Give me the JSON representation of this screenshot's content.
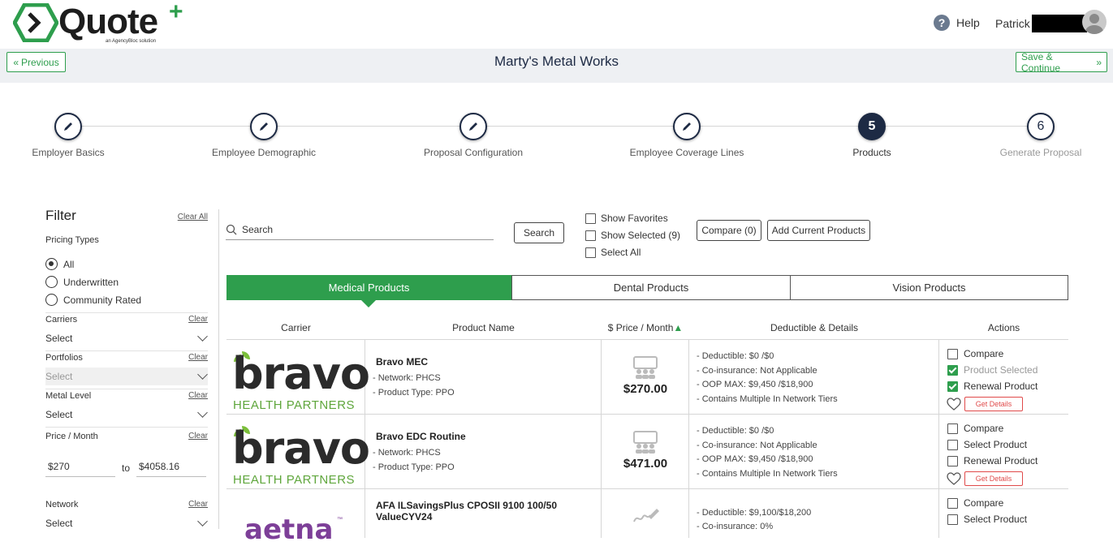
{
  "header": {
    "logo_text": "Quote",
    "logo_plus": "+",
    "logo_sub": "an AgencyBloc solution",
    "help_label": "Help",
    "user_name": "Patrick"
  },
  "nav": {
    "previous_label": "Previous",
    "company_name": "Marty's Metal Works",
    "save_label": "Save & Continue"
  },
  "steps": [
    {
      "label": "Employer Basics",
      "state": "done"
    },
    {
      "label": "Employee Demographic",
      "state": "done"
    },
    {
      "label": "Proposal Configuration",
      "state": "done"
    },
    {
      "label": "Employee Coverage Lines",
      "state": "done"
    },
    {
      "label": "Products",
      "number": "5",
      "state": "current"
    },
    {
      "label": "Generate Proposal",
      "number": "6",
      "state": "future"
    }
  ],
  "filter": {
    "title": "Filter",
    "clear_all": "Clear All",
    "pricing_types_label": "Pricing Types",
    "pricing_types": [
      "All",
      "Underwritten",
      "Community Rated"
    ],
    "pricing_selected": "All",
    "carriers": {
      "label": "Carriers",
      "clear": "Clear",
      "value": "Select"
    },
    "portfolios": {
      "label": "Portfolios",
      "clear": "Clear",
      "value": "Select"
    },
    "metal_level": {
      "label": "Metal Level",
      "clear": "Clear",
      "value": "Select"
    },
    "price_month": {
      "label": "Price / Month",
      "clear": "Clear",
      "min": "$270",
      "to": "to",
      "max": "$4058.16"
    },
    "network": {
      "label": "Network",
      "clear": "Clear",
      "value": "Select"
    }
  },
  "toolbar": {
    "search_placeholder": "Search",
    "search_button": "Search",
    "show_favorites": "Show Favorites",
    "show_selected": "Show Selected (9)",
    "select_all": "Select All",
    "compare_button": "Compare (0)",
    "add_current_button": "Add Current Products"
  },
  "tabs": [
    "Medical Products",
    "Dental Products",
    "Vision Products"
  ],
  "active_tab": "Medical Products",
  "table": {
    "headers": [
      "Carrier",
      "Product Name",
      "$ Price / Month",
      "Deductible & Details",
      "Actions"
    ],
    "sort_indicator": "▲",
    "rows": [
      {
        "carrier": "bravo",
        "carrier_sub": "HEALTH PARTNERS",
        "product_name": "Bravo MEC",
        "network": "- Network: PHCS",
        "product_type": "- Product Type: PPO",
        "price": "$270.00",
        "details": [
          "- Deductible: $0 /$0",
          "- Co-insurance: Not Applicable",
          "- OOP MAX: $9,450 /$18,900",
          "- Contains Multiple In Network Tiers"
        ],
        "actions": [
          {
            "label": "Compare",
            "checked": false,
            "dim": false
          },
          {
            "label": "Product Selected",
            "checked": true,
            "dim": true
          },
          {
            "label": "Renewal Product",
            "checked": true,
            "dim": false
          }
        ],
        "get_details": "Get Details"
      },
      {
        "carrier": "bravo",
        "carrier_sub": "HEALTH PARTNERS",
        "product_name": "Bravo EDC Routine",
        "network": "- Network: PHCS",
        "product_type": "- Product Type: PPO",
        "price": "$471.00",
        "details": [
          "- Deductible: $0 /$0",
          "- Co-insurance: Not Applicable",
          "- OOP MAX: $9,450 /$18,900",
          "- Contains Multiple In Network Tiers"
        ],
        "actions": [
          {
            "label": "Compare",
            "checked": false,
            "dim": false
          },
          {
            "label": "Select Product",
            "checked": false,
            "dim": false
          },
          {
            "label": "Renewal Product",
            "checked": false,
            "dim": false
          }
        ],
        "get_details": "Get Details"
      },
      {
        "carrier": "aetna",
        "carrier_mark": "™",
        "product_name": "AFA ILSavingsPlus CPOSII 9100 100/50 ValueCYV24",
        "price": "",
        "details": [
          "- Deductible: $9,100/$18,200",
          "- Co-insurance: 0%"
        ],
        "actions": [
          {
            "label": "Compare",
            "checked": false,
            "dim": false
          },
          {
            "label": "Select Product",
            "checked": false,
            "dim": false
          }
        ]
      }
    ]
  },
  "colors": {
    "accent": "#2e9e4d",
    "navy": "#1d2a44",
    "danger": "#e04a4a",
    "aetna": "#7d3f98"
  }
}
